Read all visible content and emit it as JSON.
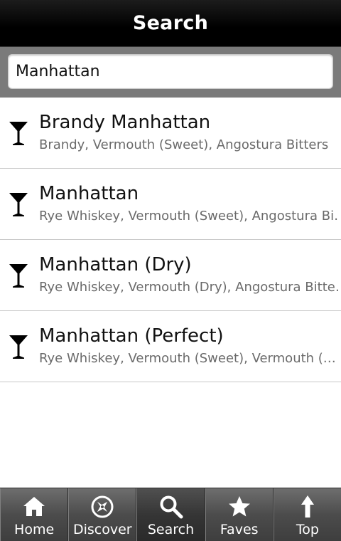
{
  "header": {
    "title": "Search"
  },
  "search": {
    "value": "Manhattan",
    "placeholder": ""
  },
  "results": [
    {
      "name": "Brandy Manhattan",
      "ingredients": "Brandy, Vermouth (Sweet), Angostura Bitters",
      "icon": "cocktail-glass-icon"
    },
    {
      "name": "Manhattan",
      "ingredients": "Rye Whiskey, Vermouth (Sweet), Angostura Bi…",
      "icon": "cocktail-glass-icon"
    },
    {
      "name": "Manhattan (Dry)",
      "ingredients": "Rye Whiskey, Vermouth (Dry), Angostura Bitte…",
      "icon": "cocktail-glass-icon"
    },
    {
      "name": "Manhattan (Perfect)",
      "ingredients": "Rye Whiskey, Vermouth (Sweet), Vermouth (…",
      "icon": "cocktail-glass-icon"
    }
  ],
  "tabs": [
    {
      "label": "Home",
      "icon": "home-icon",
      "active": false
    },
    {
      "label": "Discover",
      "icon": "compass-icon",
      "active": false
    },
    {
      "label": "Search",
      "icon": "magnifier-icon",
      "active": true
    },
    {
      "label": "Faves",
      "icon": "star-icon",
      "active": false
    },
    {
      "label": "Top",
      "icon": "up-arrow-icon",
      "active": false
    }
  ],
  "colors": {
    "titlebar": "#000000",
    "searchbar": "#7a7a7a",
    "tabbar": "#4c4c4c",
    "ingredient_text": "#6a6a6a"
  }
}
